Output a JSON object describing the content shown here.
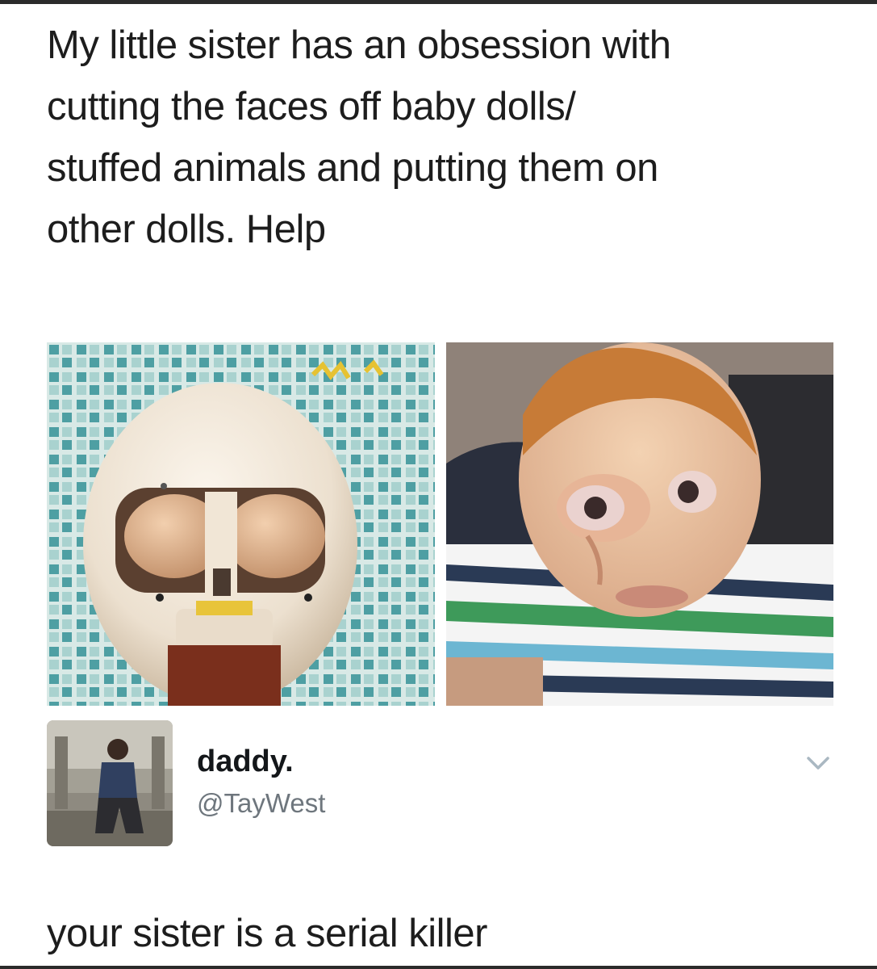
{
  "tweet": {
    "text_lines": [
      "My little sister has an obsession with",
      "cutting the faces off baby dolls/",
      "stuffed animals and putting them on",
      "other dolls. Help"
    ]
  },
  "media": {
    "left_image": "doll-head-without-face-photo",
    "right_image": "doll-wearing-cut-out-face-photo"
  },
  "reply": {
    "author": {
      "display_name": "daddy.",
      "handle": "@TayWest",
      "avatar": "profile-photo"
    },
    "menu_icon": "chevron-down-icon",
    "text": "your sister is a serial killer"
  }
}
